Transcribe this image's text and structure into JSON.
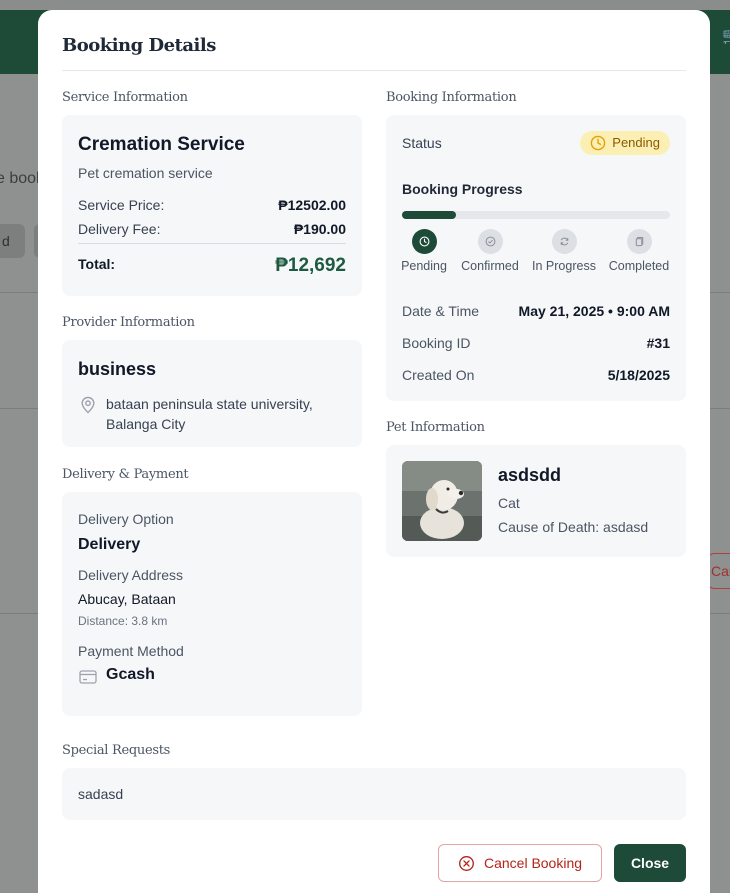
{
  "background": {
    "text_fragment": "e book",
    "chip_fragment": "d",
    "cancel_fragment": "Canc"
  },
  "modal": {
    "title": "Booking Details",
    "service": {
      "heading": "Service Information",
      "name": "Cremation Service",
      "description": "Pet cremation service",
      "price_label": "Service Price:",
      "price_value": "₱12502.00",
      "delivery_fee_label": "Delivery Fee:",
      "delivery_fee_value": "₱190.00",
      "total_label": "Total:",
      "total_value": "₱12,692"
    },
    "provider": {
      "heading": "Provider Information",
      "name": "business",
      "address": "bataan peninsula state university, Balanga City"
    },
    "delivery": {
      "heading": "Delivery & Payment",
      "option_label": "Delivery Option",
      "option_value": "Delivery",
      "address_label": "Delivery Address",
      "address_value": "Abucay, Bataan",
      "distance": "Distance: 3.8 km",
      "payment_label": "Payment Method",
      "payment_value": "Gcash"
    },
    "booking": {
      "heading": "Booking Information",
      "status_label": "Status",
      "status_value": "Pending",
      "progress_title": "Booking Progress",
      "progress_fraction": 0.2,
      "steps": [
        {
          "label": "Pending",
          "active": true
        },
        {
          "label": "Confirmed",
          "active": false
        },
        {
          "label": "In Progress",
          "active": false
        },
        {
          "label": "Completed",
          "active": false
        }
      ],
      "datetime_label": "Date & Time",
      "datetime_value": "May 21, 2025 • 9:00 AM",
      "id_label": "Booking ID",
      "id_value": "#31",
      "created_label": "Created On",
      "created_value": "5/18/2025"
    },
    "pet": {
      "heading": "Pet Information",
      "name": "asdsdd",
      "type": "Cat",
      "cause": "Cause of Death: asdasd"
    },
    "special": {
      "heading": "Special Requests",
      "text": "sadasd"
    },
    "buttons": {
      "cancel": "Cancel Booking",
      "close": "Close"
    },
    "colors": {
      "brand": "#1e4a38",
      "total": "#1e5a41",
      "pending_bg": "#fcefb4",
      "pending_text": "#8a5a00",
      "danger": "#b42318"
    }
  }
}
